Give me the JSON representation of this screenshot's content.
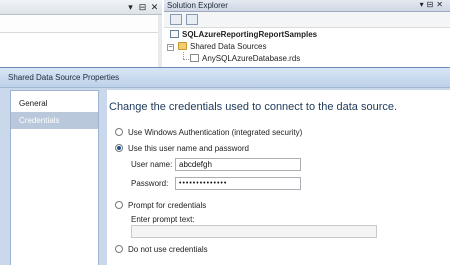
{
  "left_pane": {
    "pin_icon": "pin-icon",
    "close_icon": "close-icon"
  },
  "solution_explorer": {
    "title": "Solution Explorer",
    "tree": {
      "solution": "SQLAzureReportingReportSamples",
      "folder": "Shared Data Sources",
      "file": "AnySQLAzureDatabase.rds"
    }
  },
  "dialog": {
    "title": "Shared Data Source Properties",
    "nav": [
      {
        "label": "General"
      },
      {
        "label": "Credentials"
      }
    ],
    "heading": "Change the credentials used to connect to the data source.",
    "options": {
      "windows_auth": "Use Windows Authentication (integrated security)",
      "user_pass": "Use this user name and password",
      "prompt": "Prompt for credentials",
      "none": "Do not use credentials"
    },
    "username_label": "User name:",
    "username_value": "abcdefgh",
    "password_label": "Password:",
    "password_value": "••••••••••••••",
    "prompt_text_label": "Enter prompt text:",
    "prompt_text_value": ""
  }
}
